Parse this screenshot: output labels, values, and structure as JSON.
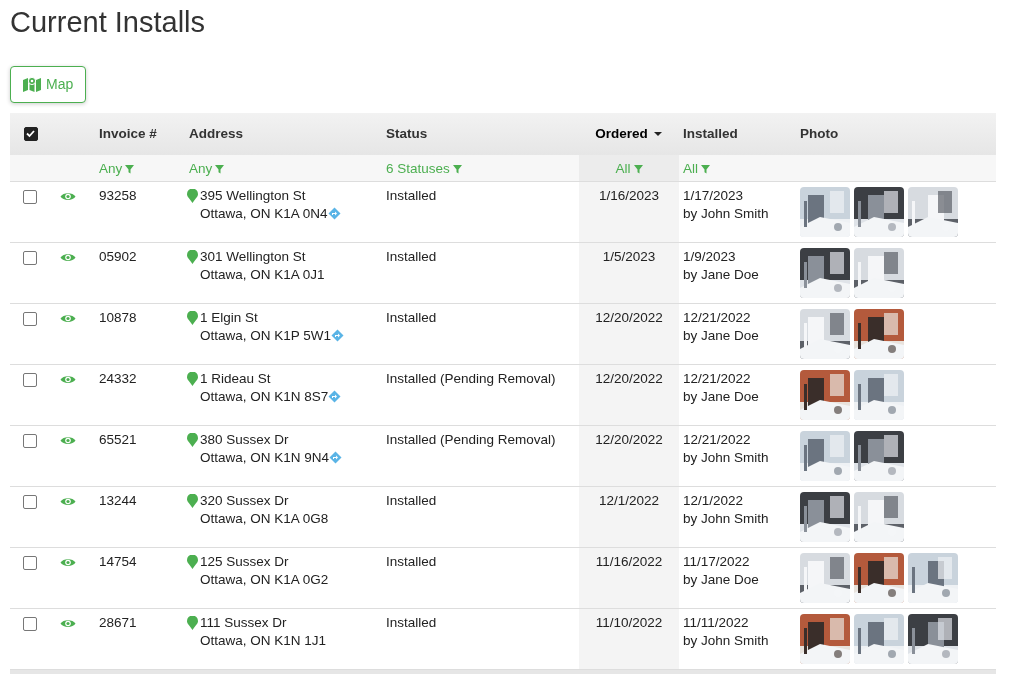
{
  "title": "Current Installs",
  "map_button": {
    "label": "Map"
  },
  "select_all": {
    "checked": true
  },
  "columns": [
    {
      "label": "Invoice #",
      "sorted": false,
      "filter": "Any"
    },
    {
      "label": "Address",
      "sorted": false,
      "filter": "Any"
    },
    {
      "label": "Status",
      "sorted": false,
      "filter": "6 Statuses"
    },
    {
      "label": "Ordered",
      "sorted": true,
      "filter": "All"
    },
    {
      "label": "Installed",
      "sorted": false,
      "filter": "All"
    },
    {
      "label": "Photo",
      "sorted": false
    }
  ],
  "rows": [
    {
      "checked": false,
      "invoice": "93258",
      "street": "395 Wellington St",
      "city": "Ottawa, ON K1A 0N4",
      "directions": true,
      "status": "Installed",
      "ordered": "1/16/2023",
      "installed": "1/17/2023",
      "installer": "by John Smith"
    },
    {
      "checked": false,
      "invoice": "05902",
      "street": "301 Wellington St",
      "city": "Ottawa, ON K1A 0J1",
      "directions": false,
      "status": "Installed",
      "ordered": "1/5/2023",
      "installed": "1/9/2023",
      "installer": "by Jane Doe"
    },
    {
      "checked": false,
      "invoice": "10878",
      "street": "1 Elgin St",
      "city": "Ottawa, ON K1P 5W1",
      "directions": true,
      "status": "Installed",
      "ordered": "12/20/2022",
      "installed": "12/21/2022",
      "installer": "by Jane Doe"
    },
    {
      "checked": false,
      "invoice": "24332",
      "street": "1 Rideau St",
      "city": "Ottawa, ON K1N 8S7",
      "directions": true,
      "status": "Installed (Pending Removal)",
      "ordered": "12/20/2022",
      "installed": "12/21/2022",
      "installer": "by Jane Doe"
    },
    {
      "checked": false,
      "invoice": "65521",
      "street": "380 Sussex Dr",
      "city": "Ottawa, ON K1N 9N4",
      "directions": true,
      "status": "Installed (Pending Removal)",
      "ordered": "12/20/2022",
      "installed": "12/21/2022",
      "installer": "by John Smith"
    },
    {
      "checked": false,
      "invoice": "13244",
      "street": "320 Sussex Dr",
      "city": "Ottawa, ON K1A 0G8",
      "directions": false,
      "status": "Installed",
      "ordered": "12/1/2022",
      "installed": "12/1/2022",
      "installer": "by John Smith"
    },
    {
      "checked": false,
      "invoice": "14754",
      "street": "125 Sussex Dr",
      "city": "Ottawa, ON K1A 0G2",
      "directions": false,
      "status": "Installed",
      "ordered": "11/16/2022",
      "installed": "11/17/2022",
      "installer": "by Jane Doe"
    },
    {
      "checked": false,
      "invoice": "28671",
      "street": "111 Sussex Dr",
      "city": "Ottawa, ON K1N 1J1",
      "directions": false,
      "status": "Installed",
      "ordered": "11/10/2022",
      "installed": "11/11/2022",
      "installer": "by John Smith"
    }
  ]
}
